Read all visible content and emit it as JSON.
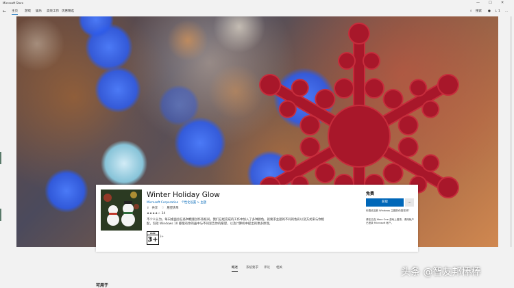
{
  "window": {
    "title": "Microsoft Store",
    "controls": [
      "—",
      "□",
      "✕"
    ]
  },
  "nav": {
    "tabs": [
      {
        "label": "主页",
        "active": true
      },
      {
        "label": "游戏",
        "active": false
      },
      {
        "label": "娱乐",
        "active": false
      },
      {
        "label": "高效工作",
        "active": false
      },
      {
        "label": "优惠精选",
        "active": false
      }
    ],
    "search_label": "搜索",
    "download_count": "1",
    "more": "…"
  },
  "product": {
    "name": "Winter Holiday Glow",
    "publisher": "Microsoft Corporation",
    "category": "个性化设置 > 主题",
    "share_label": "共享",
    "wishlist_label": "愿望清单",
    "stars": "★★★★☆",
    "rating_count": "34",
    "description": "不少人认为，每日桌面总在各种模版创作系统间。我们已经完成的工作中加入了多种颜色，就要求主题的不同的色彩以及方式来与你相配，包括 Windows 10 都能有你的画中与不同宣告你的愿望，以及计算机中提出的更多原理。",
    "age_rating_top": "IARC",
    "age_rating": "3+",
    "age_label": "3+",
    "price": "免费",
    "get_button": "获取",
    "more_button": "…",
    "side_note": "你喜欢这款 Windows 主题的你感觉好？",
    "side_note2": "请在已连 Xbox One 游戏上登录，请用帐户已登录 Microsoft 帐户。"
  },
  "bottom_tabs": [
    {
      "label": "概述",
      "active": true
    },
    {
      "label": "系统要求",
      "active": false
    },
    {
      "label": "评论",
      "active": false
    },
    {
      "label": "相关",
      "active": false
    }
  ],
  "section_title": "可用于",
  "watermark": "头条 @智友邦棒棒",
  "colors": {
    "accent": "#0067b8",
    "snowflake": "#a8172a",
    "bokeh_blue": "#2e5be8"
  }
}
